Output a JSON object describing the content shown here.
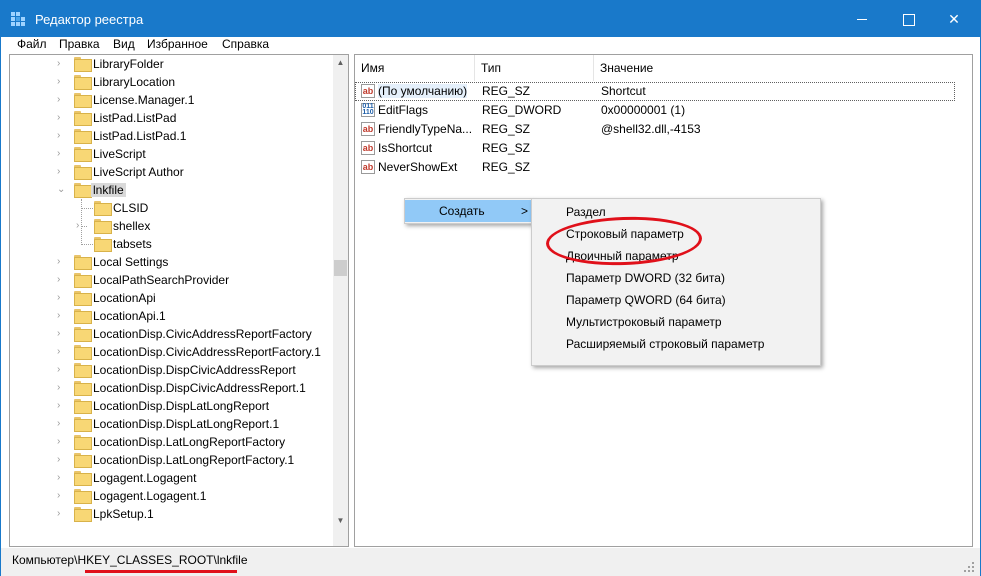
{
  "window": {
    "title": "Редактор реестра",
    "accent_color": "#1979ca",
    "controls": {
      "minimize_icon": "minimize-icon",
      "maximize_icon": "maximize-icon",
      "close_icon": "close-icon",
      "close_glyph": "✕"
    }
  },
  "menu": [
    "Файл",
    "Правка",
    "Вид",
    "Избранное",
    "Справка"
  ],
  "tree": {
    "items": [
      {
        "label": "LibraryFolder",
        "state": "collapsed"
      },
      {
        "label": "LibraryLocation",
        "state": "collapsed"
      },
      {
        "label": "License.Manager.1",
        "state": "collapsed"
      },
      {
        "label": "ListPad.ListPad",
        "state": "collapsed"
      },
      {
        "label": "ListPad.ListPad.1",
        "state": "collapsed"
      },
      {
        "label": "LiveScript",
        "state": "collapsed"
      },
      {
        "label": "LiveScript Author",
        "state": "collapsed"
      },
      {
        "label": "lnkfile",
        "state": "expanded",
        "selected": true
      },
      {
        "label": "CLSID",
        "state": "leaf",
        "child": true
      },
      {
        "label": "shellex",
        "state": "collapsed",
        "child": true
      },
      {
        "label": "tabsets",
        "state": "leaf",
        "child": true
      },
      {
        "label": "Local Settings",
        "state": "collapsed"
      },
      {
        "label": "LocalPathSearchProvider",
        "state": "collapsed"
      },
      {
        "label": "LocationApi",
        "state": "collapsed"
      },
      {
        "label": "LocationApi.1",
        "state": "collapsed"
      },
      {
        "label": "LocationDisp.CivicAddressReportFactory",
        "state": "collapsed"
      },
      {
        "label": "LocationDisp.CivicAddressReportFactory.1",
        "state": "collapsed"
      },
      {
        "label": "LocationDisp.DispCivicAddressReport",
        "state": "collapsed"
      },
      {
        "label": "LocationDisp.DispCivicAddressReport.1",
        "state": "collapsed"
      },
      {
        "label": "LocationDisp.DispLatLongReport",
        "state": "collapsed"
      },
      {
        "label": "LocationDisp.DispLatLongReport.1",
        "state": "collapsed"
      },
      {
        "label": "LocationDisp.LatLongReportFactory",
        "state": "collapsed"
      },
      {
        "label": "LocationDisp.LatLongReportFactory.1",
        "state": "collapsed"
      },
      {
        "label": "Logagent.Logagent",
        "state": "collapsed"
      },
      {
        "label": "Logagent.Logagent.1",
        "state": "collapsed"
      },
      {
        "label": "LpkSetup.1",
        "state": "collapsed"
      }
    ],
    "scroll_up_glyph": "▲",
    "scroll_down_glyph": "▼",
    "expanded_glyph": "⌄",
    "collapsed_glyph": "›"
  },
  "values": {
    "columns": [
      "Имя",
      "Тип",
      "Значение"
    ],
    "rows": [
      {
        "name": "(По умолчанию)",
        "type": "REG_SZ",
        "data": "Shortcut",
        "icon": "ab",
        "focused": true
      },
      {
        "name": "EditFlags",
        "type": "REG_DWORD",
        "data": "0x00000001 (1)",
        "icon": "binary"
      },
      {
        "name": "FriendlyTypeNa...",
        "type": "REG_SZ",
        "data": "@shell32.dll,-4153",
        "icon": "ab"
      },
      {
        "name": "IsShortcut",
        "type": "REG_SZ",
        "data": "",
        "icon": "ab"
      },
      {
        "name": "NeverShowExt",
        "type": "REG_SZ",
        "data": "",
        "icon": "ab"
      }
    ],
    "ab_icon_text": "ab",
    "binary_icon_text": "011\n110"
  },
  "context_menu": {
    "create_label": "Создать",
    "submenu_arrow": ">",
    "submenu": [
      "Раздел",
      "Строковый параметр",
      "Двоичный параметр",
      "Параметр DWORD (32 бита)",
      "Параметр QWORD (64 бита)",
      "Мультистроковый параметр",
      "Расширяемый строковый параметр"
    ],
    "highlight_color": "#91c9f7",
    "annotation_color": "#e0101a"
  },
  "status": {
    "path": "Компьютер\\HKEY_CLASSES_ROOT\\lnkfile"
  }
}
